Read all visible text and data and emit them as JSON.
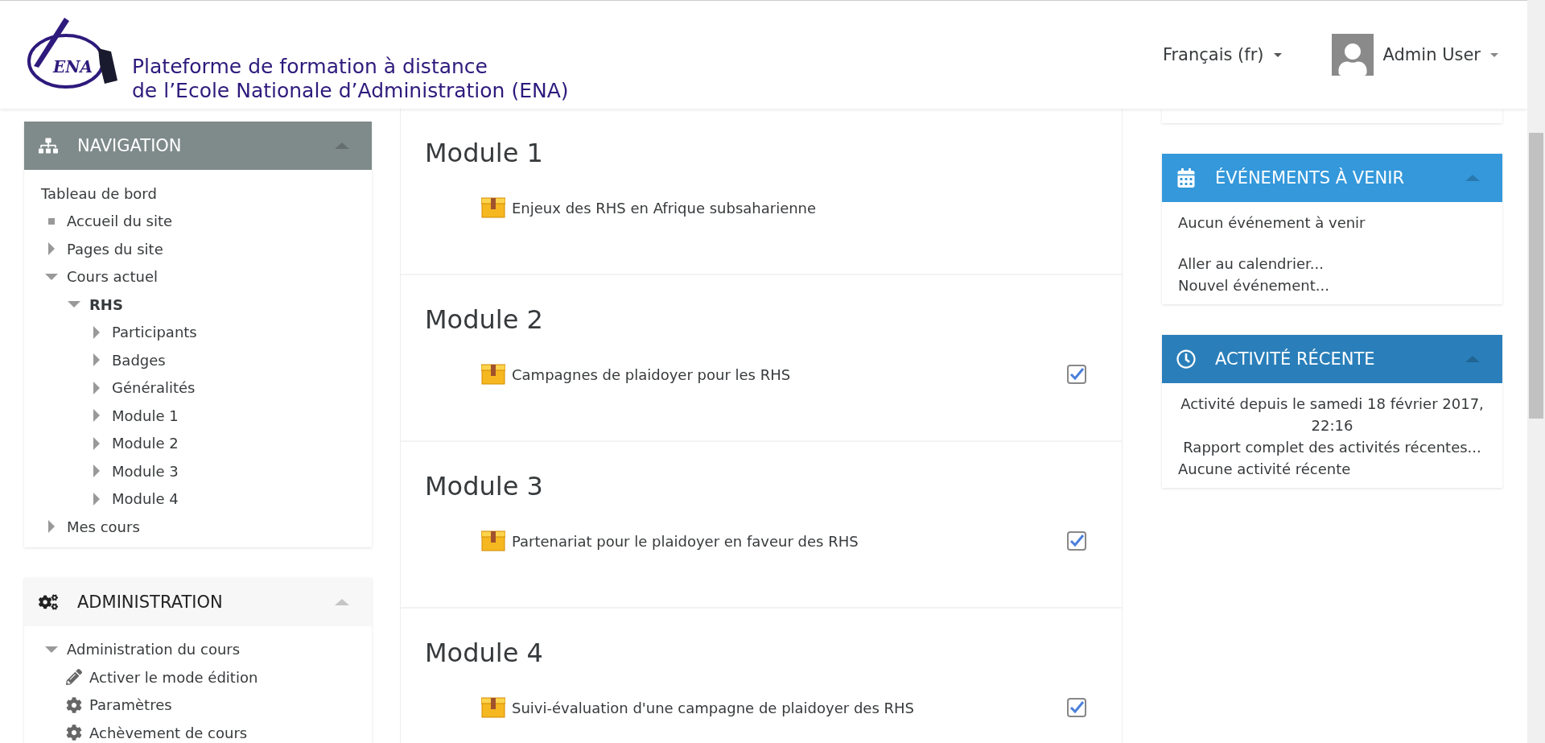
{
  "header": {
    "logo_text": "ENA",
    "title_lines": [
      "Plateforme de formation à distance",
      "de l’Ecole Nationale d’Administration (ENA)"
    ],
    "language": "Français (fr)",
    "user": "Admin User"
  },
  "left_blocks": [
    {
      "title": "NAVIGATION",
      "color": "#7f8b8a",
      "tree": [
        {
          "label": "Tableau de bord",
          "kind": "root",
          "children": [
            {
              "label": "Accueil du site",
              "kind": "leaf"
            },
            {
              "label": "Pages du site",
              "kind": "branch",
              "expanded": false
            },
            {
              "label": "Cours actuel",
              "kind": "branch",
              "expanded": true,
              "children": [
                {
                  "label": "RHS",
                  "kind": "branch",
                  "expanded": true,
                  "current": true,
                  "children": [
                    {
                      "label": "Participants",
                      "kind": "branch",
                      "expanded": false
                    },
                    {
                      "label": "Badges",
                      "kind": "branch",
                      "expanded": false
                    },
                    {
                      "label": "Généralités",
                      "kind": "branch",
                      "expanded": false
                    },
                    {
                      "label": "Module 1",
                      "kind": "branch",
                      "expanded": false
                    },
                    {
                      "label": "Module 2",
                      "kind": "branch",
                      "expanded": false
                    },
                    {
                      "label": "Module 3",
                      "kind": "branch",
                      "expanded": false
                    },
                    {
                      "label": "Module 4",
                      "kind": "branch",
                      "expanded": false
                    }
                  ]
                }
              ]
            },
            {
              "label": "Mes cours",
              "kind": "branch",
              "expanded": false
            }
          ]
        }
      ]
    },
    {
      "title": "ADMINISTRATION",
      "color": "#f7f7f7",
      "tree": [
        {
          "label": "Administration du cours",
          "kind": "branch",
          "expanded": true,
          "children": [
            {
              "label": "Activer le mode édition",
              "kind": "edit"
            },
            {
              "label": "Paramètres",
              "kind": "settings"
            },
            {
              "label": "Achèvement de cours",
              "kind": "settings"
            }
          ]
        }
      ]
    }
  ],
  "sections": [
    {
      "title": "Module 1",
      "activities": [
        {
          "name": "Enjeux des RHS en Afrique subsaharienne"
        }
      ]
    },
    {
      "title": "Module 2",
      "activities": [
        {
          "name": "Campagnes de plaidoyer pour les RHS",
          "checked": true
        }
      ]
    },
    {
      "title": "Module 3",
      "activities": [
        {
          "name": "Partenariat pour le plaidoyer en faveur des RHS",
          "checked": true
        }
      ]
    },
    {
      "title": "Module 4",
      "activities": [
        {
          "name": "Suivi-évaluation d'une campagne de plaidoyer des RHS",
          "checked": true
        }
      ]
    }
  ],
  "right_blocks": [
    {
      "title": "ÉVÉNEMENTS À VENIR",
      "color": "#3498db",
      "paragraphs": [
        [
          {
            "text": "Aucun événement à venir",
            "kind": "note"
          }
        ],
        [
          {
            "text": "Aller au calendrier...",
            "kind": "link"
          },
          {
            "text": "Nouvel événement...",
            "kind": "link"
          }
        ]
      ]
    },
    {
      "title": "ACTIVITÉ RÉCENTE",
      "color": "#2a7fba",
      "paragraphs": [
        [
          {
            "text": "Activité depuis le samedi 18 février 2017, 22:16",
            "kind": "centered"
          },
          {
            "text": "Rapport complet des activités récentes...",
            "kind": "centered-link"
          },
          {
            "text": "Aucune activité récente",
            "kind": "note"
          }
        ]
      ]
    }
  ]
}
